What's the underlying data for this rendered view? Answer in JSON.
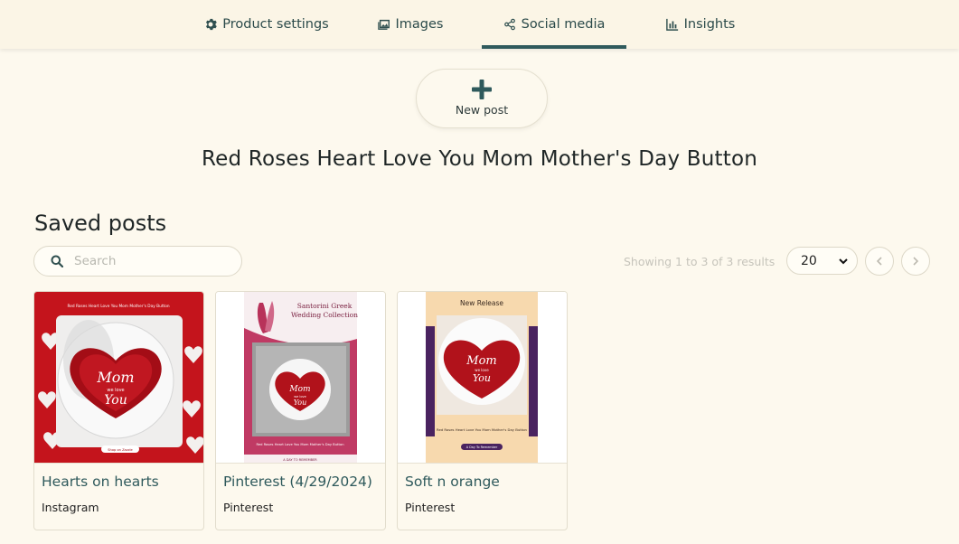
{
  "tabs": {
    "product_settings": "Product settings",
    "images": "Images",
    "social_media": "Social media",
    "insights": "Insights"
  },
  "new_post": {
    "label": "New post"
  },
  "product_title": "Red Roses Heart Love You Mom Mother's Day Button",
  "saved_posts": {
    "heading": "Saved posts",
    "search_placeholder": "Search",
    "results_info": "Showing 1 to 3 of 3 results",
    "per_page": "20",
    "posts": [
      {
        "title": "Hearts on hearts",
        "platform": "Instagram",
        "thumb_text": {
          "top": "Red Roses Heart Love You Mom Mother's Day Button",
          "heart_line1": "Mom",
          "heart_line2": "we love",
          "heart_line3": "You",
          "cta": "Shop on Zazzle"
        }
      },
      {
        "title": "Pinterest (4/29/2024)",
        "platform": "Pinterest",
        "thumb_text": {
          "top": "Santorini Greek Wedding Collection",
          "heart_line1": "Mom",
          "heart_line2": "we love",
          "heart_line3": "You",
          "caption": "Red Roses Heart Love You Mom Mother's Day Button",
          "bottom": "A DAY TO REMEMBER"
        }
      },
      {
        "title": "Soft n orange",
        "platform": "Pinterest",
        "thumb_text": {
          "top": "New Release",
          "heart_line1": "Mom",
          "heart_line2": "we love",
          "heart_line3": "You",
          "caption": "Red Roses Heart Love You Mom Mother's Day Button",
          "cta": "A Day To Remember"
        }
      }
    ]
  },
  "colors": {
    "background": "#fdf9ee",
    "accent": "#2f5a5c",
    "rose": "#b3121d"
  }
}
